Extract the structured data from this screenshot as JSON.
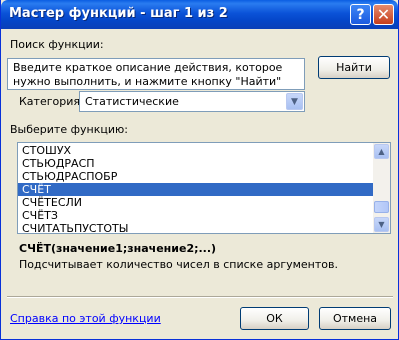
{
  "window": {
    "title": "Мастер функций - шаг 1 из 2",
    "help_glyph": "?",
    "close_glyph": "✕"
  },
  "search": {
    "label": "Поиск функции:",
    "text": "Введите краткое описание действия, которое нужно выполнить, и нажмите кнопку \"Найти\"",
    "find_button": "Найти"
  },
  "category": {
    "label": "Категория:",
    "value": "Статистические"
  },
  "functions": {
    "label": "Выберите функцию:",
    "items": [
      "СТОШУХ",
      "СТЬЮДРАСП",
      "СТЬЮДРАСПОБР",
      "СЧЁТ",
      "СЧЁТЕСЛИ",
      "СЧЁТЗ",
      "СЧИТАТЬПУСТОТЫ"
    ],
    "selected": "СЧЁТ"
  },
  "selected_function": {
    "signature": "СЧЁТ(значение1;значение2;...)",
    "description": "Подсчитывает количество чисел в списке аргументов."
  },
  "footer": {
    "help_link": "Справка по этой функции",
    "ok_button": "ОК",
    "cancel_button": "Отмена"
  }
}
